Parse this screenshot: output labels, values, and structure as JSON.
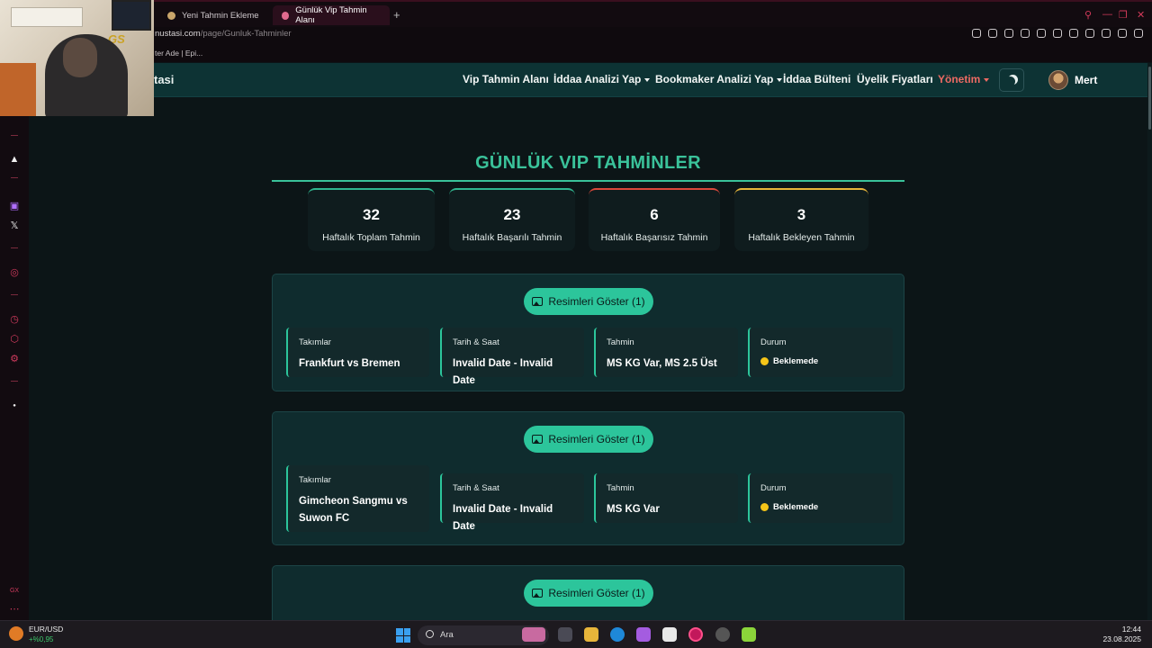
{
  "browser": {
    "tabs": [
      {
        "label": "Yeni Tahmin Ekleme",
        "active": false
      },
      {
        "label": "Günlük Vip Tahmin Alanı",
        "active": true
      }
    ],
    "url_host": "nustasi.com",
    "url_path": "/page/Gunluk-Tahminler",
    "bookmark": "ter Ade | Epi..."
  },
  "nav": {
    "brand": "tasi",
    "items": [
      "Vip Tahmin Alanı",
      "İddaa Analizi Yap",
      "Bookmaker Analizi Yap",
      "İddaa Bülteni",
      "Üyelik Fiyatları",
      "Yönetim"
    ],
    "user": "Mert"
  },
  "page": {
    "title": "GÜNLÜK VIP TAHMİNLER"
  },
  "stats": [
    {
      "value": "32",
      "label": "Haftalık Toplam Tahmin",
      "color": "#2fb58f"
    },
    {
      "value": "23",
      "label": "Haftalık Başarılı Tahmin",
      "color": "#2fb58f"
    },
    {
      "value": "6",
      "label": "Haftalık Başarısız Tahmin",
      "color": "#d9483b"
    },
    {
      "value": "3",
      "label": "Haftalık Bekleyen Tahmin",
      "color": "#e6b53a"
    }
  ],
  "labels": {
    "show_images": "Resimleri Göster (1)",
    "teams": "Takımlar",
    "datetime": "Tarih & Saat",
    "prediction": "Tahmin",
    "status": "Durum"
  },
  "predictions": [
    {
      "teams": "Frankfurt vs Bremen",
      "datetime": "Invalid Date - Invalid Date",
      "prediction": "MS KG Var, MS 2.5 Üst",
      "status": "Beklemede"
    },
    {
      "teams": "Gimcheon Sangmu vs Suwon FC",
      "datetime": "Invalid Date - Invalid Date",
      "prediction": "MS KG Var",
      "status": "Beklemede"
    }
  ],
  "taskbar": {
    "ticker_symbol": "EUR/USD",
    "ticker_change": "+%0,95",
    "search_placeholder": "Ara",
    "time": "12:44",
    "date": "23.08.2025"
  },
  "colors": {
    "accent": "#2cc59b",
    "pending": "#f5c518",
    "admin": "#ec6a63"
  }
}
